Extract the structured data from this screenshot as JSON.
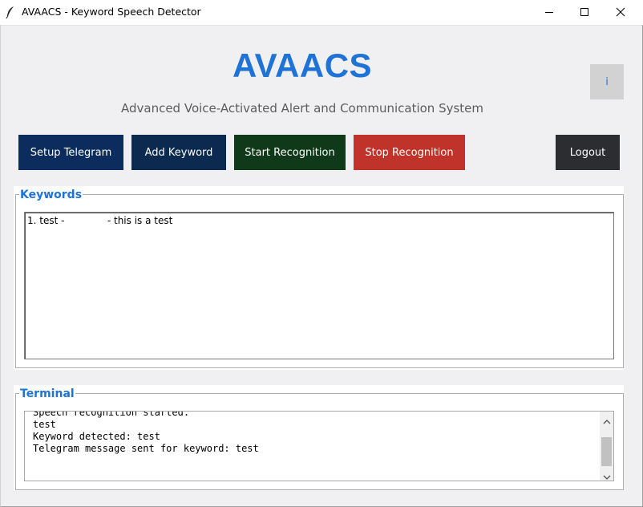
{
  "window": {
    "title": "AVAACS - Keyword Speech Detector",
    "controls": [
      "minimize-icon",
      "maximize-icon",
      "close-icon"
    ]
  },
  "header": {
    "title": "AVAACS",
    "subtitle": "Advanced Voice-Activated Alert and Communication System",
    "info_label": "i"
  },
  "toolbar": {
    "setup_telegram": "Setup Telegram",
    "add_keyword": "Add Keyword",
    "start_recognition": "Start Recognition",
    "stop_recognition": "Stop Recognition",
    "logout": "Logout"
  },
  "keywords": {
    "legend": "Keywords",
    "items": [
      "1. test -              - this is a test"
    ]
  },
  "terminal": {
    "legend": "Terminal",
    "lines": [
      "Speech recognition started.",
      "test",
      "Keyword detected: test",
      "Telegram message sent for keyword: test"
    ]
  },
  "colors": {
    "accent": "#1f73d6",
    "setup_button": "#0b2c5c",
    "add_button": "#0c2a4f",
    "start_button": "#0f3919",
    "stop_button": "#c0332b",
    "logout_button": "#2b2d30"
  }
}
